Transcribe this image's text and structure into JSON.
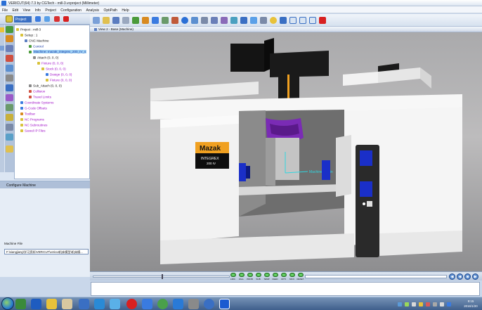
{
  "window": {
    "title": "VERICUT(64) 7.3 by CGTech - mill-3.vcproject (Millimeter)"
  },
  "menubar": {
    "items": [
      "File",
      "Edit",
      "View",
      "Info",
      "Project",
      "Configuration",
      "Analysis",
      "OptiPath",
      "Help"
    ]
  },
  "left_panel": {
    "tab_label": "Project",
    "tree": [
      {
        "label": "Project : mill-3",
        "color": "black"
      },
      {
        "label": "Setup : 1",
        "color": "black"
      },
      {
        "label": "CNC Machine",
        "color": "black"
      },
      {
        "label": "Control",
        "color": "blue"
      },
      {
        "label": "Machine: mazak_integrex_200_IV_s",
        "color": "blue",
        "selected": true
      },
      {
        "label": "Attach (0, 0, 0)",
        "color": "black"
      },
      {
        "label": "Fixture (0, 0, 0)",
        "color": "purple"
      },
      {
        "label": "Stock (0, 0, 0)",
        "color": "purple"
      },
      {
        "label": "Design (0, 0, 0)",
        "color": "purple"
      },
      {
        "label": "Fixture (0, 0, 0)",
        "color": "purple"
      },
      {
        "label": "Sub_Attach (0, 0, 0)",
        "color": "black"
      },
      {
        "label": "Collision",
        "color": "purple"
      },
      {
        "label": "Travel Limits",
        "color": "purple"
      },
      {
        "label": "Coordinate Systems",
        "color": "purple"
      },
      {
        "label": "G-Code Offsets",
        "color": "purple"
      },
      {
        "label": "Toolbar",
        "color": "purple"
      },
      {
        "label": "NC Programs",
        "color": "purple"
      },
      {
        "label": "NC Subroutines",
        "color": "purple"
      },
      {
        "label": "Saved IP Files",
        "color": "purple"
      }
    ],
    "config_header": "Configure Machine",
    "machine_file_label": "Machine File",
    "machine_file_value": "F:\\xiangjiang\\学习资料\\VERICUT\\vericut机床模型\\机床模..."
  },
  "view": {
    "title": "View 2 - Base (Machine)",
    "brand": "Mazak",
    "model_line1": "INTEGREX",
    "model_line2": "200 IV",
    "axis_label": "Machine Origin"
  },
  "bottombar": {
    "leds": [
      "LMIC",
      "FALL",
      "PROB",
      "SUB",
      "TEMP",
      "FEED",
      "OPTI",
      "MCO",
      "RESET"
    ],
    "play_buttons": [
      "rewind",
      "step-back",
      "stop",
      "play",
      "step-forward"
    ]
  },
  "taskbar": {
    "time": "9:15",
    "date": "2016/1/20"
  },
  "colors": {
    "accent": "#3a6fc3",
    "machine_white": "#f7f7f7",
    "machine_black": "#111111",
    "spindle_purple": "#7a2bb5",
    "screen_blue": "#1a2fc8",
    "mazak_orange": "#f0a020"
  }
}
